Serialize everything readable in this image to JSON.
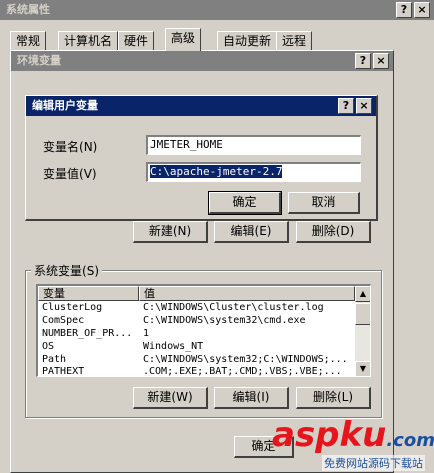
{
  "system_props": {
    "title": "系统属性",
    "tabs": [
      "常规",
      "计算机名",
      "硬件",
      "高级",
      "自动更新",
      "远程"
    ],
    "active_tab_index": 3
  },
  "env_vars": {
    "title": "环境变量",
    "user_buttons": {
      "new": "新建",
      "new_key": "(N)",
      "edit": "编辑",
      "edit_key": "(E)",
      "delete": "删除",
      "delete_key": "(D)"
    },
    "system_group_label": "系统变量",
    "system_group_key": "(S)",
    "columns": [
      "变量",
      "值"
    ],
    "system_rows": [
      {
        "name": "ClusterLog",
        "value": "C:\\WINDOWS\\Cluster\\cluster.log"
      },
      {
        "name": "ComSpec",
        "value": "C:\\WINDOWS\\system32\\cmd.exe"
      },
      {
        "name": "NUMBER_OF_PR...",
        "value": "1"
      },
      {
        "name": "OS",
        "value": "Windows_NT"
      },
      {
        "name": "Path",
        "value": "C:\\WINDOWS\\system32;C:\\WINDOWS;..."
      },
      {
        "name": "PATHEXT",
        "value": ".COM;.EXE;.BAT;.CMD;.VBS;.VBE;..."
      }
    ],
    "system_buttons": {
      "new": "新建",
      "new_key": "(W)",
      "edit": "编辑",
      "edit_key": "(I)",
      "delete": "删除",
      "delete_key": "(L)"
    },
    "ok": "确定"
  },
  "edit_dialog": {
    "title": "编辑用户变量",
    "name_label": "变量名",
    "name_key": "(N)",
    "name_value": "JMETER_HOME",
    "value_label": "变量值",
    "value_key": "(V)",
    "value_value": "C:\\apache-jmeter-2.7",
    "ok": "确定",
    "cancel": "取消"
  },
  "titlebar_buttons": {
    "help": "?",
    "close": "×"
  },
  "watermark": {
    "brand": "aspku",
    "suffix": ".com",
    "tagline": "免费网站源码下载站"
  },
  "colors": {
    "active_title": "#0a246a",
    "inactive_title": "#808080",
    "face": "#d4d0c8",
    "wm_red": "#e8141c",
    "wm_blue": "#1a4fa0"
  }
}
